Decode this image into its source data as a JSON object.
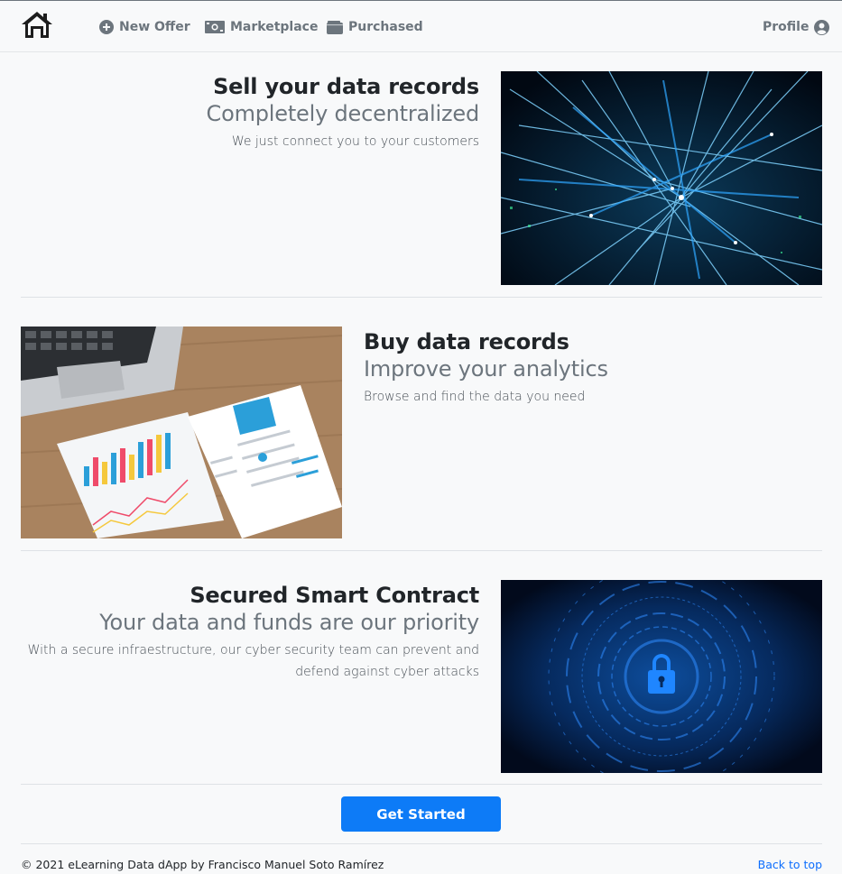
{
  "nav": {
    "home_icon": "home-icon",
    "items": [
      {
        "label": "New Offer",
        "icon": "plus-circle-icon"
      },
      {
        "label": "Marketplace",
        "icon": "money-bill-icon"
      },
      {
        "label": "Purchased",
        "icon": "wallet-icon"
      }
    ],
    "profile": {
      "label": "Profile",
      "icon": "user-circle-icon"
    }
  },
  "sections": [
    {
      "heading": "Sell your data records",
      "subheading": "Completely decentralized",
      "description": "We just connect you to your customers",
      "image": "network-lines-image"
    },
    {
      "heading": "Buy data records",
      "subheading": "Improve your analytics",
      "description": "Browse and find the data you need",
      "image": "analytics-reports-laptop-image"
    },
    {
      "heading": "Secured Smart Contract",
      "subheading": "Your data and funds are our priority",
      "description_line1": "With a secure infraestructure, our cyber security team can prevent and",
      "description_line2": "defend against cyber attacks",
      "image": "cyber-lock-image"
    }
  ],
  "cta": {
    "label": "Get Started"
  },
  "footer": {
    "copyright": "© 2021 eLearning Data dApp by Francisco Manuel Soto Ramírez",
    "back_to_top": "Back to top"
  },
  "colors": {
    "accent": "#0d7bf7",
    "muted": "#6c757d",
    "background": "#f8f9fa"
  }
}
